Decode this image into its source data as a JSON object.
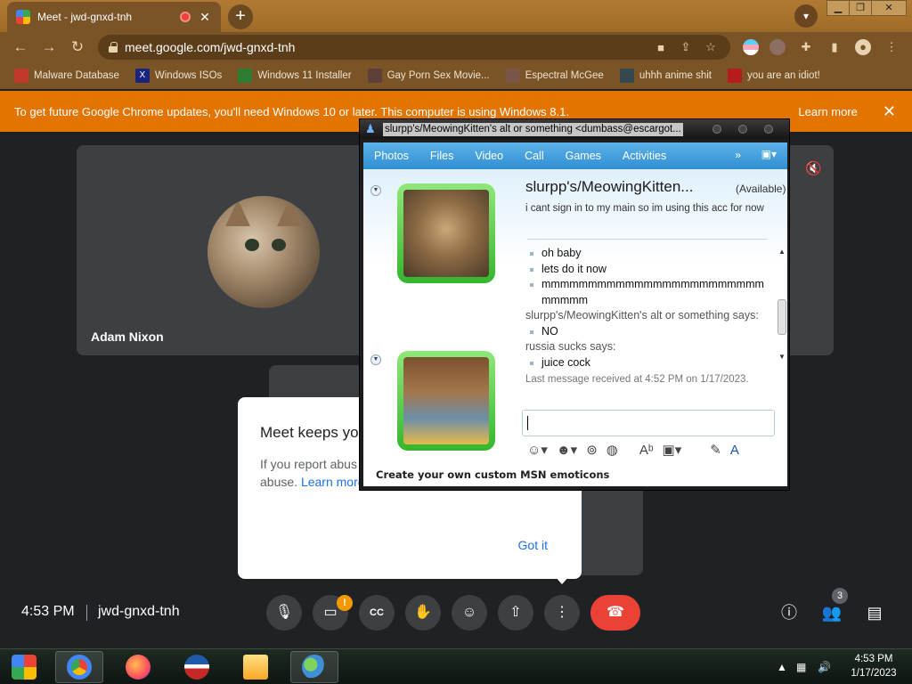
{
  "browser": {
    "tab_title": "Meet - jwd-gnxd-tnh",
    "tab_close": "✕",
    "new_tab": "+",
    "url": "meet.google.com/jwd-gnxd-tnh",
    "bookmarks": [
      {
        "label": "Malware Database",
        "color": "#c0392b"
      },
      {
        "label": "Windows ISOs",
        "color": "#1a237e"
      },
      {
        "label": "Windows 11 Installer",
        "color": "#2e7d32"
      },
      {
        "label": "Gay Porn Sex Movie...",
        "color": "#5d4037"
      },
      {
        "label": "Espectral McGee",
        "color": "#795548"
      },
      {
        "label": "uhhh anime shit",
        "color": "#37474f"
      },
      {
        "label": "you are an idiot!",
        "color": "#b71c1c"
      }
    ],
    "infobar": {
      "message": "To get future Google Chrome updates, you'll need Windows 10 or later. This computer is using Windows 8.1.",
      "learn_more": "Learn more",
      "close": "✕"
    }
  },
  "meet": {
    "participant_name": "Adam Nixon",
    "popup": {
      "title": "Meet keeps yo",
      "body": "If you report abus option of sending to verify the abuse.",
      "link": "Learn more about reporting abuse",
      "button": "Got it"
    },
    "time": "4:53 PM",
    "meeting_code": "jwd-gnxd-tnh",
    "camera_alert": "!",
    "people_count": "3"
  },
  "msn": {
    "title": "slurpp's/MeowingKitten's alt or something <dumbass@escargot...",
    "tabs": [
      "Photos",
      "Files",
      "Video",
      "Call",
      "Games",
      "Activities"
    ],
    "more": "»",
    "contact_name": "slurpp's/MeowingKitten...",
    "contact_status": "(Available)",
    "contact_psm": "i cant sign in to my main so im using this acc for now",
    "messages": {
      "m1": "oh baby",
      "m2": "lets do it now",
      "m3": "mmmmmmmmmmmmmmmmmmmmmmmmmmmmm",
      "speaker1": "slurpp's/MeowingKitten's alt or something says:",
      "m4": "NO",
      "speaker2": "russia sucks says:",
      "m5": "juice cock",
      "last_received": "Last message received at 4:52 PM on 1/17/2023."
    },
    "promo": "Create your own custom MSN emoticons"
  },
  "taskbar": {
    "clock_time": "4:53 PM",
    "clock_date": "1/17/2023"
  },
  "colors": {
    "infobar": "#e37400",
    "end_call": "#ea4335",
    "meet_bg": "#202124",
    "msn_blue": "#2f8fd3"
  }
}
